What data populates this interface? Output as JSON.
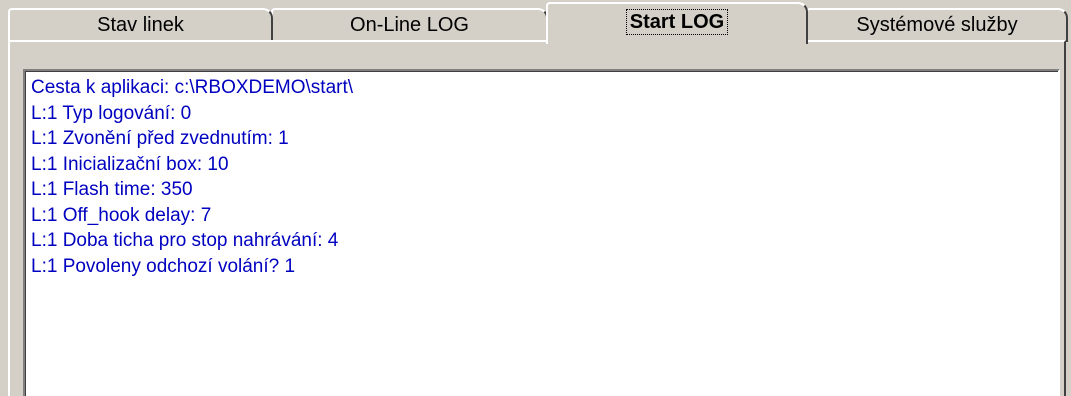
{
  "tabs": [
    {
      "label": "Stav linek",
      "active": false
    },
    {
      "label": "On-Line LOG",
      "active": false
    },
    {
      "label": "Start LOG",
      "active": true
    },
    {
      "label": "Systémové služby",
      "active": false
    }
  ],
  "log": {
    "text_color": "#0000c0",
    "lines": [
      "Cesta k aplikaci: c:\\RBOXDEMO\\start\\",
      "L:1 Typ logování: 0",
      "L:1 Zvonění před zvednutím: 1",
      "L:1 Inicializační box: 10",
      "L:1 Flash time: 350",
      "L:1 Off_hook delay: 7",
      "L:1 Doba ticha pro stop nahrávání: 4",
      "L:1 Povoleny odchozí volání? 1"
    ]
  }
}
